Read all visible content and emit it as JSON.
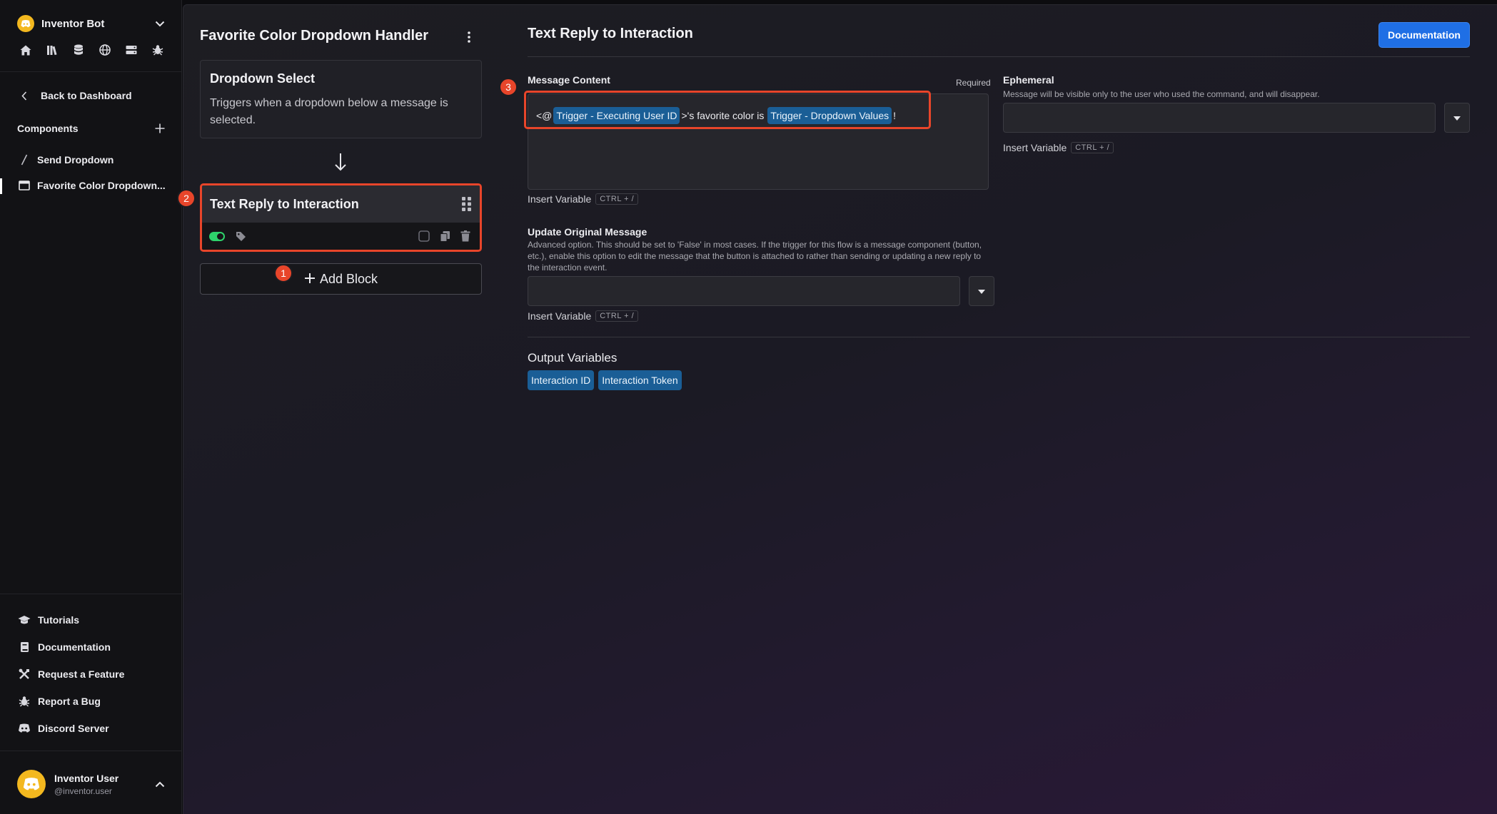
{
  "sidebar": {
    "bot_name": "Inventor Bot",
    "quick_icons": [
      "home-icon",
      "library-icon",
      "database-icon",
      "globe-icon",
      "server-icon",
      "bug-icon"
    ],
    "back_label": "Back to Dashboard",
    "components_label": "Components",
    "components": [
      {
        "label": "Send Dropdown",
        "icon": "slash-command-icon"
      },
      {
        "label": "Favorite Color Dropdown...",
        "icon": "window-icon"
      }
    ],
    "footer_links": [
      {
        "label": "Tutorials",
        "icon": "graduation-cap-icon"
      },
      {
        "label": "Documentation",
        "icon": "book-icon"
      },
      {
        "label": "Request a Feature",
        "icon": "tools-icon"
      },
      {
        "label": "Report a Bug",
        "icon": "bug-icon"
      },
      {
        "label": "Discord Server",
        "icon": "discord-icon"
      }
    ],
    "user": {
      "name": "Inventor User",
      "handle": "@inventor.user"
    }
  },
  "flow": {
    "title": "Favorite Color Dropdown Handler",
    "trigger": {
      "title": "Dropdown Select",
      "description": "Triggers when a dropdown below a message is selected."
    },
    "action": {
      "title": "Text Reply to Interaction",
      "enabled": true
    },
    "add_block_label": "Add Block"
  },
  "annotations": [
    "1",
    "2",
    "3"
  ],
  "panel": {
    "title": "Text Reply to Interaction",
    "doc_button": "Documentation",
    "message_content": {
      "label": "Message Content",
      "required": "Required",
      "prefix": "<@",
      "var1": "Trigger - Executing User ID",
      "middle": ">'s favorite color is",
      "var2": "Trigger - Dropdown Values",
      "suffix": "!"
    },
    "insert_variable": "Insert Variable",
    "shortcut": "CTRL + /",
    "ephemeral": {
      "label": "Ephemeral",
      "help": "Message will be visible only to the user who used the command, and will disappear.",
      "value": ""
    },
    "update_original": {
      "label": "Update Original Message",
      "help": "Advanced option. This should be set to 'False' in most cases. If the trigger for this flow is a message component (button, etc.), enable this option to edit the message that the button is attached to rather than sending or updating a new reply to the interaction event.",
      "value": ""
    },
    "output": {
      "title": "Output Variables",
      "vars": [
        "Interaction ID",
        "Interaction Token"
      ]
    }
  },
  "colors": {
    "accent": "#1f6fe5",
    "chip": "#1a5e96",
    "highlight": "#e8452a",
    "toggle_on": "#2ed36b",
    "bot_avatar": "#f3b81f"
  }
}
